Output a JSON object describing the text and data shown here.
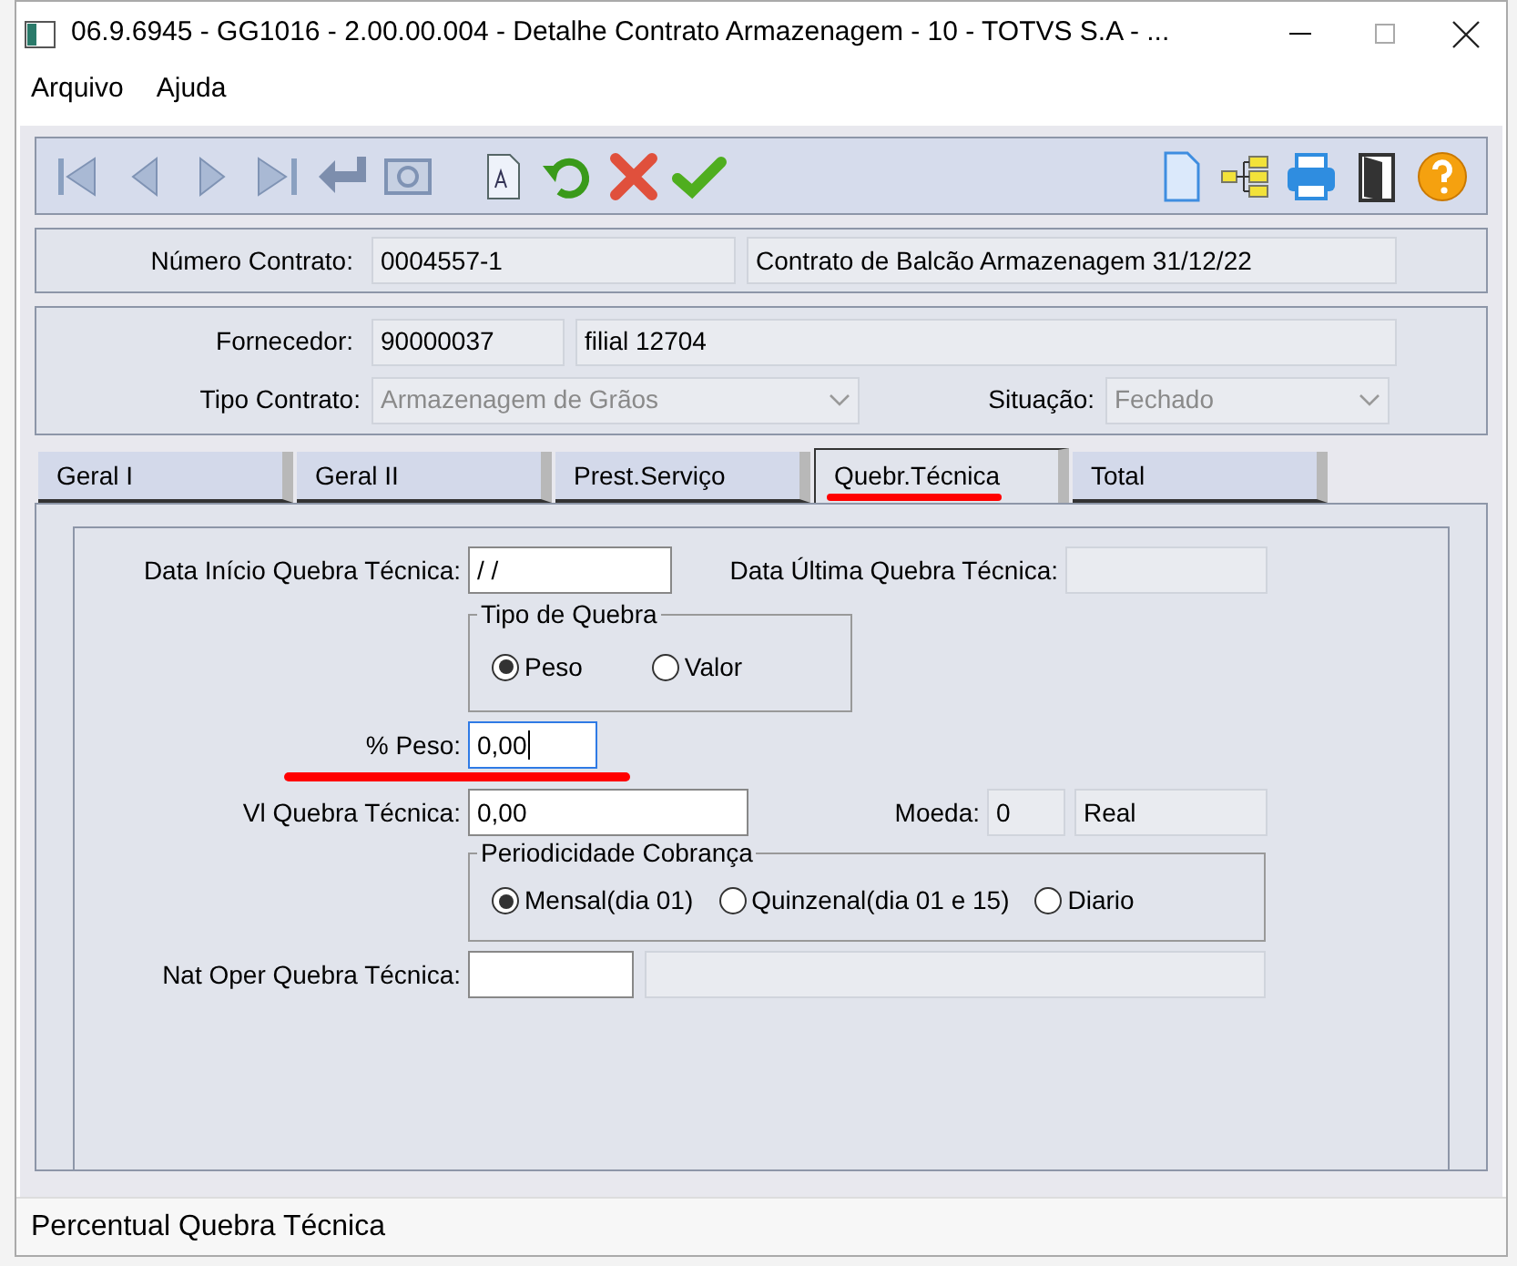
{
  "window": {
    "title": "06.9.6945 - GG1016 - 2.00.00.004 - Detalhe Contrato Armazenagem - 10 - TOTVS S.A - ..."
  },
  "menu": [
    "Arquivo",
    "Ajuda"
  ],
  "contract": {
    "label": "Número Contrato:",
    "number": "0004557-1",
    "description": "Contrato de Balcão Armazenagem 31/12/22"
  },
  "supplier": {
    "label": "Fornecedor:",
    "code": "90000037",
    "name": "filial 12704"
  },
  "contract_type": {
    "label": "Tipo Contrato:",
    "value": "Armazenagem de Grãos",
    "disabled": true
  },
  "status": {
    "label": "Situação:",
    "value": "Fechado",
    "disabled": true
  },
  "tabs": [
    {
      "label": "Geral I",
      "selected": false
    },
    {
      "label": "Geral II",
      "selected": false
    },
    {
      "label": "Prest.Serviço",
      "selected": false
    },
    {
      "label": "Quebr.Técnica",
      "selected": true
    },
    {
      "label": "Total",
      "selected": false
    }
  ],
  "form": {
    "start_date": {
      "label": "Data Início Quebra Técnica:",
      "value": "/ /"
    },
    "last_date": {
      "label": "Data Última Quebra Técnica:"
    },
    "break_type": {
      "title": "Tipo de Quebra",
      "options": [
        {
          "label": "Peso",
          "selected": true
        },
        {
          "label": "Valor",
          "selected": false
        }
      ]
    },
    "weight_pct": {
      "label": "% Peso:",
      "value": "0,00",
      "focused": true
    },
    "break_value": {
      "label": "Vl Quebra Técnica:",
      "value": "0,00"
    },
    "currency": {
      "label": "Moeda:",
      "code": "0",
      "name": "Real"
    },
    "periodicity": {
      "title": "Periodicidade Cobrança",
      "options": [
        {
          "label": "Mensal(dia 01)",
          "selected": true
        },
        {
          "label": "Quinzenal(dia 01 e 15)",
          "selected": false
        },
        {
          "label": "Diario",
          "selected": false
        }
      ]
    },
    "nat_oper": {
      "label": "Nat Oper Quebra Técnica:"
    }
  },
  "status_bar": "Percentual Quebra Técnica"
}
